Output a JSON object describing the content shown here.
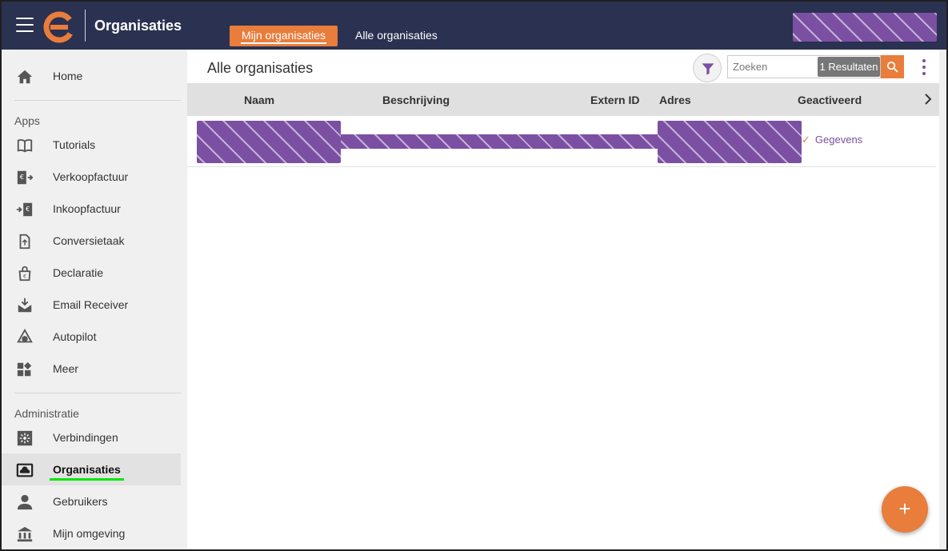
{
  "header": {
    "app_title": "Organisaties",
    "tabs": [
      {
        "label": "Mijn organisaties",
        "active": true
      },
      {
        "label": "Alle organisaties",
        "active": false
      }
    ]
  },
  "sidebar": {
    "top_items": [
      {
        "label": "Home",
        "icon": "home-icon"
      }
    ],
    "apps_label": "Apps",
    "apps": [
      {
        "label": "Tutorials",
        "icon": "book-icon"
      },
      {
        "label": "Verkoopfactuur",
        "icon": "sales-invoice-icon"
      },
      {
        "label": "Inkoopfactuur",
        "icon": "purchase-invoice-icon"
      },
      {
        "label": "Conversietaak",
        "icon": "conversion-icon"
      },
      {
        "label": "Declaratie",
        "icon": "expense-bag-icon"
      },
      {
        "label": "Email Receiver",
        "icon": "email-receiver-icon"
      },
      {
        "label": "Autopilot",
        "icon": "autopilot-icon"
      },
      {
        "label": "Meer",
        "icon": "widgets-icon"
      }
    ],
    "admin_label": "Administratie",
    "admin": [
      {
        "label": "Verbindingen",
        "icon": "connections-icon"
      },
      {
        "label": "Organisaties",
        "icon": "organisation-icon",
        "active": true
      },
      {
        "label": "Gebruikers",
        "icon": "user-icon"
      },
      {
        "label": "Mijn omgeving",
        "icon": "bank-icon"
      }
    ]
  },
  "main": {
    "title": "Alle organisaties",
    "search_placeholder": "Zoeken",
    "result_count": "1 Resultaten",
    "columns": [
      "Naam",
      "Beschrijving",
      "Extern ID",
      "Adres",
      "Geactiveerd"
    ],
    "rows": [
      {
        "activated_link": "Gegevens"
      }
    ]
  },
  "colors": {
    "topbar": "#2b3150",
    "accent": "#e97d3c",
    "brand_purple": "#7b4fa2",
    "active_underline": "#00e600"
  }
}
